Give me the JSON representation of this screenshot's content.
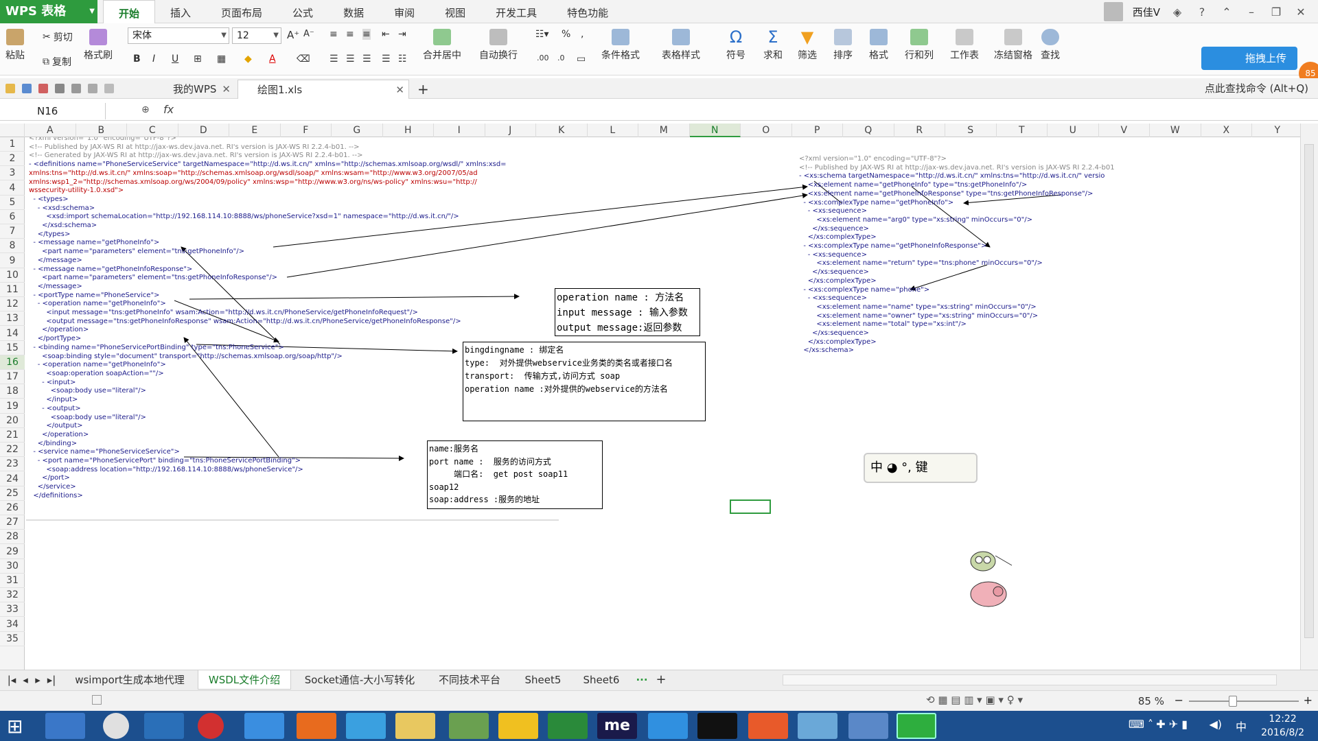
{
  "app": {
    "name": "WPS 表格"
  },
  "menu": {
    "tabs": [
      "开始",
      "插入",
      "页面布局",
      "公式",
      "数据",
      "审阅",
      "视图",
      "开发工具",
      "特色功能"
    ],
    "active": "开始"
  },
  "user": {
    "name": "西佳V"
  },
  "ribbon": {
    "paste": "粘贴",
    "cut": "剪切",
    "copy": "复制",
    "format_painter": "格式刷",
    "font": "宋体",
    "size": "12",
    "merge": "合并居中",
    "wrap": "自动换行",
    "conditional": "条件格式",
    "table_style": "表格样式",
    "symbol": "符号",
    "sum": "求和",
    "filter": "筛选",
    "sort": "排序",
    "format": "格式",
    "rows_cols": "行和列",
    "worksheet": "工作表",
    "freeze": "冻结窗格",
    "find": "查找",
    "upload": "拖拽上传",
    "badge": "85"
  },
  "doctabs": {
    "mywps": "我的WPS",
    "file": "绘图1.xls",
    "search": "点此查找命令 (Alt+Q)"
  },
  "formula": {
    "namebox": "N16",
    "fx": "fx",
    "value": ""
  },
  "columns": [
    "A",
    "B",
    "C",
    "D",
    "E",
    "F",
    "G",
    "H",
    "I",
    "J",
    "K",
    "L",
    "M",
    "N",
    "O",
    "P",
    "Q",
    "R",
    "S",
    "T",
    "U",
    "V",
    "W",
    "X",
    "Y"
  ],
  "selected_col": "N",
  "rows": [
    "1",
    "2",
    "3",
    "4",
    "5",
    "6",
    "7",
    "8",
    "9",
    "10",
    "11",
    "12",
    "13",
    "14",
    "15",
    "16",
    "17",
    "18",
    "19",
    "20",
    "21",
    "22",
    "23",
    "24",
    "25",
    "26",
    "27",
    "28",
    "29",
    "30",
    "31",
    "32",
    "33",
    "34",
    "35"
  ],
  "selected_row": "16",
  "wsdl_lines": [
    "<?xml version=\"1.0\" encoding=\"UTF-8\"?>",
    "<!-- Published by JAX-WS RI at http://jax-ws.dev.java.net. RI's version is JAX-WS RI 2.2.4-b01. -->",
    "<!-- Generated by JAX-WS RI at http://jax-ws.dev.java.net. RI's version is JAX-WS RI 2.2.4-b01. -->",
    "- <definitions name=\"PhoneServiceService\" targetNamespace=\"http://d.ws.it.cn/\" xmlns=\"http://schemas.xmlsoap.org/wsdl/\" xmlns:xsd=",
    "xmlns:tns=\"http://d.ws.it.cn/\" xmlns:soap=\"http://schemas.xmlsoap.org/wsdl/soap/\" xmlns:wsam=\"http://www.w3.org/2007/05/ad",
    "xmlns:wsp1_2=\"http://schemas.xmlsoap.org/ws/2004/09/policy\" xmlns:wsp=\"http://www.w3.org/ns/ws-policy\" xmlns:wsu=\"http://",
    "wssecurity-utility-1.0.xsd\">",
    "  - <types>",
    "    - <xsd:schema>",
    "        <xsd:import schemaLocation=\"http://192.168.114.10:8888/ws/phoneService?xsd=1\" namespace=\"http://d.ws.it.cn/\"/>",
    "      </xsd:schema>",
    "    </types>",
    "  - <message name=\"getPhoneInfo\">",
    "      <part name=\"parameters\" element=\"tns:getPhoneInfo\"/>",
    "    </message>",
    "  - <message name=\"getPhoneInfoResponse\">",
    "      <part name=\"parameters\" element=\"tns:getPhoneInfoResponse\"/>",
    "    </message>",
    "  - <portType name=\"PhoneService\">",
    "    - <operation name=\"getPhoneInfo\">",
    "        <input message=\"tns:getPhoneInfo\" wsam:Action=\"http://d.ws.it.cn/PhoneService/getPhoneInfoRequest\"/>",
    "        <output message=\"tns:getPhoneInfoResponse\" wsam:Action=\"http://d.ws.it.cn/PhoneService/getPhoneInfoResponse\"/>",
    "      </operation>",
    "    </portType>",
    "  - <binding name=\"PhoneServicePortBinding\" type=\"tns:PhoneService\">",
    "      <soap:binding style=\"document\" transport=\"http://schemas.xmlsoap.org/soap/http\"/>",
    "    - <operation name=\"getPhoneInfo\">",
    "        <soap:operation soapAction=\"\"/>",
    "      - <input>",
    "          <soap:body use=\"literal\"/>",
    "        </input>",
    "      - <output>",
    "          <soap:body use=\"literal\"/>",
    "        </output>",
    "      </operation>",
    "    </binding>",
    "  - <service name=\"PhoneServiceService\">",
    "    - <port name=\"PhoneServicePort\" binding=\"tns:PhoneServicePortBinding\">",
    "        <soap:address location=\"http://192.168.114.10:8888/ws/phoneService\"/>",
    "      </port>",
    "    </service>",
    "  </definitions>"
  ],
  "xsd_lines": [
    "<?xml version=\"1.0\" encoding=\"UTF-8\"?>",
    "<!-- Published by JAX-WS RI at http://jax-ws.dev.java.net. RI's version is JAX-WS RI 2.2.4-b01",
    "- <xs:schema targetNamespace=\"http://d.ws.it.cn/\" xmlns:tns=\"http://d.ws.it.cn/\" versio",
    "    <xs:element name=\"getPhoneInfo\" type=\"tns:getPhoneInfo\"/>",
    "    <xs:element name=\"getPhoneInfoResponse\" type=\"tns:getPhoneInfoResponse\"/>",
    "  - <xs:complexType name=\"getPhoneInfo\">",
    "    - <xs:sequence>",
    "        <xs:element name=\"arg0\" type=\"xs:string\" minOccurs=\"0\"/>",
    "      </xs:sequence>",
    "    </xs:complexType>",
    "  - <xs:complexType name=\"getPhoneInfoResponse\">",
    "    - <xs:sequence>",
    "        <xs:element name=\"return\" type=\"tns:phone\" minOccurs=\"0\"/>",
    "      </xs:sequence>",
    "    </xs:complexType>",
    "  - <xs:complexType name=\"phone\">",
    "    - <xs:sequence>",
    "        <xs:element name=\"name\" type=\"xs:string\" minOccurs=\"0\"/>",
    "        <xs:element name=\"owner\" type=\"xs:string\" minOccurs=\"0\"/>",
    "        <xs:element name=\"total\" type=\"xs:int\"/>",
    "      </xs:sequence>",
    "    </xs:complexType>",
    "  </xs:schema>"
  ],
  "notes": {
    "operation": [
      "operation name : 方法名",
      "input message : 输入参数",
      "output message:返回参数"
    ],
    "binding": [
      "bingdingname : 绑定名",
      "type:  对外提供webservice业务类的类名或者接口名",
      "transport:  传输方式,访问方式 soap",
      "operation name :对外提供的webservice的方法名"
    ],
    "service": [
      "name:服务名",
      "port name :  服务的访问方式",
      "     端口名:  get post soap11",
      "soap12",
      "soap:address :服务的地址"
    ]
  },
  "ime": {
    "label": "中 ◕ °, 键"
  },
  "sheets": [
    "wsimport生成本地代理",
    "WSDL文件介绍",
    "Socket通信-大小写转化",
    "不同技术平台",
    "Sheet5",
    "Sheet6"
  ],
  "active_sheet": "WSDL文件介绍",
  "status": {
    "zoom": "85 %"
  },
  "clock": {
    "time": "12:22",
    "date": "2016/8/2"
  },
  "tray": {
    "ime": "中"
  },
  "colors": {
    "accent": "#2e9b3e",
    "taskbar": "#1c4f8e",
    "upload": "#2b8ee0"
  }
}
